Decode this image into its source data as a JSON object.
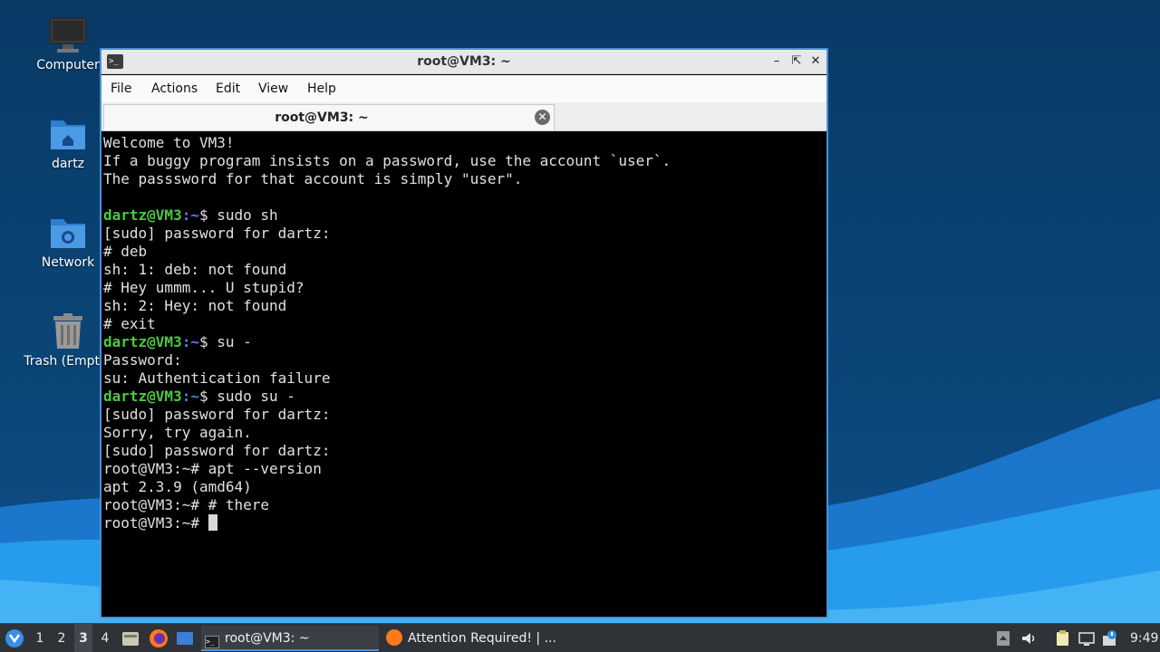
{
  "desktop": {
    "icons": [
      {
        "label": "Computer",
        "icon": "computer-icon"
      },
      {
        "label": "dartz",
        "icon": "home-folder-icon"
      },
      {
        "label": "Network",
        "icon": "network-folder-icon"
      },
      {
        "label": "Trash (Empty)",
        "icon": "trash-icon"
      }
    ],
    "colors": {
      "wallpaper_dark": "#0a3a66",
      "wallpaper_wave": "#1e90e8"
    }
  },
  "window": {
    "title": "root@VM3: ~",
    "controls": [
      "minimize-icon",
      "maximize-icon",
      "close-icon"
    ],
    "menu": [
      "File",
      "Actions",
      "Edit",
      "View",
      "Help"
    ],
    "tab": {
      "label": "root@VM3: ~"
    }
  },
  "terminal": {
    "welcome": [
      "Welcome to VM3!",
      "If a buggy program insists on a password, use the account `user`.",
      "The passsword for that account is simply \"user\"."
    ],
    "prompt_user": "dartz@VM3",
    "prompt_path": ":~",
    "prompt_sign": "$ ",
    "cmd1": "sudo sh",
    "out1": [
      "[sudo] password for dartz:",
      "# deb",
      "sh: 1: deb: not found",
      "# Hey ummm... U stupid?",
      "sh: 2: Hey: not found",
      "# exit"
    ],
    "cmd2": "su -",
    "out2": [
      "Password:",
      "su: Authentication failure"
    ],
    "cmd3": "sudo su -",
    "out3": [
      "[sudo] password for dartz:",
      "Sorry, try again.",
      "[sudo] password for dartz:",
      "root@VM3:~# apt --version",
      "apt 2.3.9 (amd64)",
      "root@VM3:~# # there"
    ],
    "root_prompt": "root@VM3:~# ",
    "colors": {
      "user": "#4cc93f",
      "path": "#5c7cf0",
      "text": "#e0e0e0"
    }
  },
  "taskbar": {
    "workspaces": [
      "1",
      "2",
      "3",
      "4"
    ],
    "active_workspace": "3",
    "launchers": [
      "file-manager-icon",
      "firefox-icon",
      "desktop-icon"
    ],
    "tasks": [
      {
        "label": "root@VM3: ~",
        "icon": "terminal-icon",
        "active": true
      },
      {
        "label": "Attention Required! | ...",
        "icon": "firefox-icon",
        "active": false
      }
    ],
    "tray": [
      "eject-icon",
      "volume-icon",
      "clipboard-icon",
      "display-icon",
      "update-notifier-icon"
    ],
    "clock": "9:49"
  }
}
